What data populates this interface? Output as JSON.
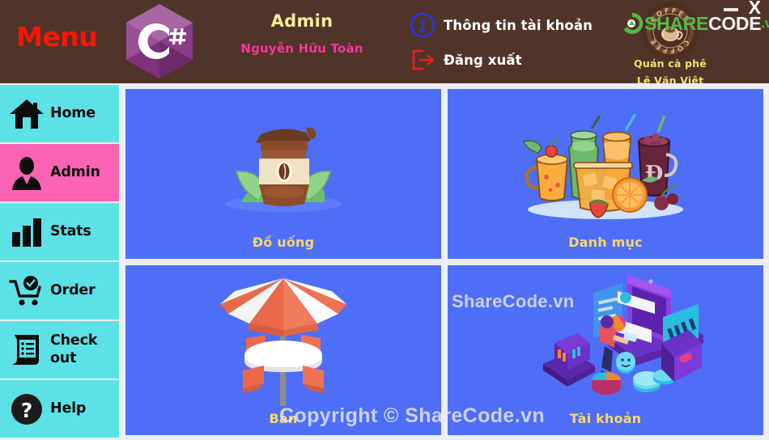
{
  "window": {
    "minimize_label": "—",
    "close_label": "X"
  },
  "header": {
    "menu_title": "Menu",
    "logo_icon": "csharp-logo-icon",
    "logo_text": "C#",
    "admin_role": "Admin",
    "admin_name": "Nguyễn Hữu Toàn",
    "links": [
      {
        "label": "Thông tin tài khoản",
        "icon": "info-circle-icon",
        "color": "#2b35e0"
      },
      {
        "label": "Đăng xuất",
        "icon": "logout-icon",
        "color": "#ef1d1d"
      }
    ],
    "brand": {
      "badge_icon": "coffee-badge-icon",
      "badge_text_top": "COFFEE",
      "badge_text_bottom": "COFFEE",
      "line1": "Quán cà phê",
      "line2": "Lê Văn Việt"
    }
  },
  "sidebar": {
    "items": [
      {
        "label": "Home",
        "icon": "home-icon",
        "active": false
      },
      {
        "label": "Admin",
        "icon": "user-tie-icon",
        "active": true
      },
      {
        "label": "Stats",
        "icon": "bar-chart-icon",
        "active": false
      },
      {
        "label": "Order",
        "icon": "cart-check-icon",
        "active": false
      },
      {
        "label": "Check out",
        "icon": "receipt-icon",
        "active": false
      },
      {
        "label": "Help",
        "icon": "question-circle-icon",
        "active": false
      }
    ]
  },
  "main": {
    "tiles": [
      {
        "label": "Đồ uống",
        "art": "coffee-cup-art"
      },
      {
        "label": "Danh mục",
        "art": "drinks-group-art"
      },
      {
        "label": "Bàn",
        "art": "patio-table-umbrella-art"
      },
      {
        "label": "Tài khoản",
        "art": "finance-isometric-art"
      }
    ]
  },
  "watermarks": {
    "copyright": "Copyright © ShareCode.vn",
    "sharecode": "ShareCode.vn",
    "top_share": "SHARE",
    "top_code": "CODE",
    "top_vn": ".vn"
  },
  "colors": {
    "header_bg": "#50342a",
    "sidebar_bg": "#5ce1e6",
    "sidebar_active": "#fc63b4",
    "tile_bg": "#4f6ef7",
    "tile_label": "#f6d86b",
    "menu_red": "#fb1505",
    "admin_yellow": "#f2ef9a",
    "admin_pink": "#f7359e",
    "brand_yellow": "#f4df6e"
  }
}
